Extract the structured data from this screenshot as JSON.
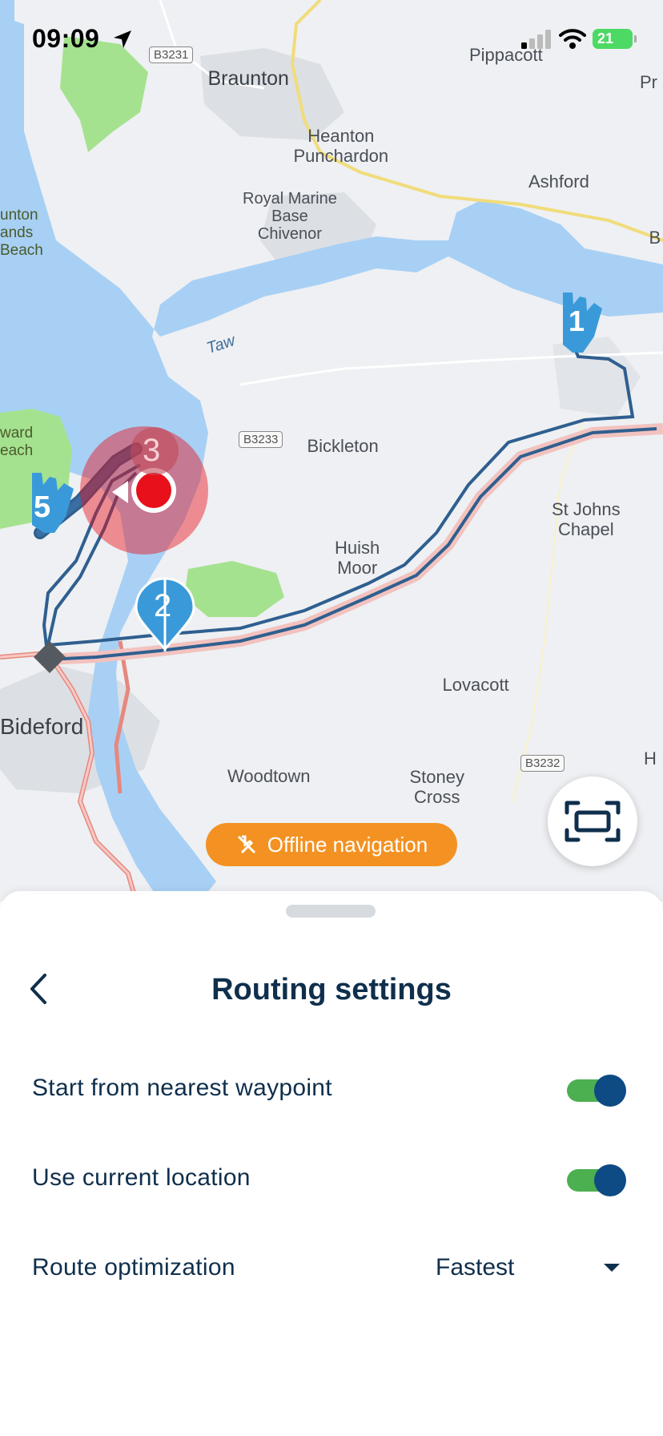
{
  "status_bar": {
    "time": "09:09",
    "battery": "21"
  },
  "map": {
    "places": {
      "braunton": "Braunton",
      "pippacott": "Pippacott",
      "heanton": "Heanton\nPunchardon",
      "ashford": "Ashford",
      "chivenor": "Royal Marine\nBase\nChivenor",
      "sands": "unton\nands\nBeach",
      "taw": "Taw",
      "ward_beach": "ward\neach",
      "bickleton": "Bickleton",
      "st_johns": "St Johns\nChapel",
      "huish": "Huish\nMoor",
      "lovacott": "Lovacott",
      "bideford": "Bideford",
      "woodtown": "Woodtown",
      "stoney_cross": "Stoney\nCross",
      "pr": "Pr",
      "b_edge": "B",
      "h_edge": "H"
    },
    "road_shields": {
      "b3231": "B3231",
      "b3233": "B3233",
      "b3232": "B3232"
    },
    "waypoints": [
      "1",
      "2",
      "3",
      "5"
    ],
    "offline_label": "Offline navigation",
    "colors": {
      "water": "#a8d0f5",
      "route": "#2f5f8f",
      "pill": "#f39222",
      "waypoint": "#3a9ad9",
      "current": "#e8101a"
    }
  },
  "sheet": {
    "title": "Routing settings",
    "rows": [
      {
        "label": "Start from nearest waypoint",
        "toggle": true
      },
      {
        "label": "Use current location",
        "toggle": true
      },
      {
        "label": "Route optimization",
        "value": "Fastest"
      }
    ]
  }
}
